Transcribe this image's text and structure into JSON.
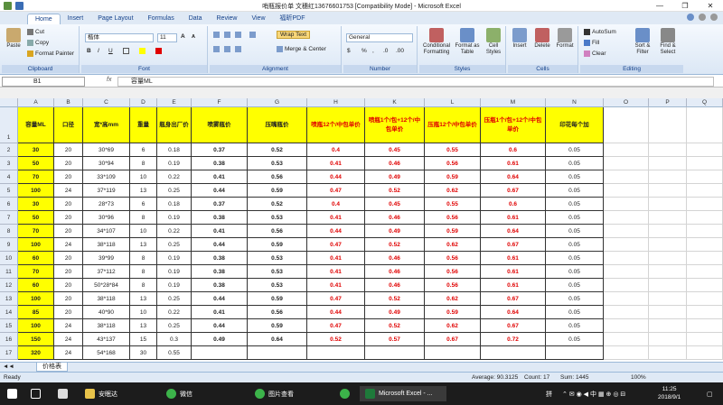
{
  "window": {
    "title": "哨瓶报价单 文穗红13676601753 [Compatibility Mode] - Microsoft Excel",
    "minimize": "—",
    "restore": "❐",
    "close": "✕"
  },
  "tabs": [
    "Home",
    "Insert",
    "Page Layout",
    "Formulas",
    "Data",
    "Review",
    "View",
    "福昕PDF"
  ],
  "ribbon": {
    "clipboard": {
      "label": "Clipboard",
      "paste": "Paste",
      "cut": "Cut",
      "copy": "Copy",
      "format_painter": "Format Painter"
    },
    "font": {
      "label": "Font",
      "font_name": "楷体",
      "font_size": "11",
      "bold": "B",
      "italic": "I",
      "underline": "U",
      "grow": "A",
      "shrink": "A"
    },
    "alignment": {
      "label": "Alignment",
      "wrap_text": "Wrap Text",
      "merge_center": "Merge & Center"
    },
    "number": {
      "label": "Number",
      "format": "General",
      "currency": "$",
      "percent": "%",
      "comma": ",",
      "inc_dec": ".0",
      "dec_dec": ".00"
    },
    "styles": {
      "label": "Styles",
      "conditional": "Conditional Formatting",
      "format_table": "Format as Table",
      "cell_styles": "Cell Styles"
    },
    "cells": {
      "label": "Cells",
      "insert": "Insert",
      "delete": "Delete",
      "format": "Format"
    },
    "editing": {
      "label": "Editing",
      "autosum": "AutoSum",
      "fill": "Fill",
      "clear": "Clear",
      "sort_filter": "Sort & Filter",
      "find_select": "Find & Select"
    }
  },
  "formula_bar": {
    "name_box": "B1",
    "fx": "fx",
    "content": "容量ML"
  },
  "columns": [
    "A",
    "B",
    "C",
    "D",
    "E",
    "F",
    "G",
    "H",
    "K",
    "L",
    "M",
    "N",
    "O",
    "P",
    "Q",
    "R"
  ],
  "headers": [
    "容量ML",
    "口径",
    "宽*高mm",
    "重量",
    "瓶身出厂价",
    "喷雾瓶价",
    "压嘴瓶价",
    "喷瓶12个/中包单价",
    "喷瓶1个/包+12个/中包单价",
    "压瓶12个/中包单价",
    "压瓶1个/包+12个/中包单价",
    "印花每个加"
  ],
  "rows": [
    [
      "30",
      "20",
      "30*69",
      "6",
      "0.18",
      "0.37",
      "0.52",
      "0.4",
      "0.45",
      "0.55",
      "0.6",
      "0.05"
    ],
    [
      "50",
      "20",
      "30*94",
      "8",
      "0.19",
      "0.38",
      "0.53",
      "0.41",
      "0.46",
      "0.56",
      "0.61",
      "0.05"
    ],
    [
      "70",
      "20",
      "33*109",
      "10",
      "0.22",
      "0.41",
      "0.56",
      "0.44",
      "0.49",
      "0.59",
      "0.64",
      "0.05"
    ],
    [
      "100",
      "24",
      "37*119",
      "13",
      "0.25",
      "0.44",
      "0.59",
      "0.47",
      "0.52",
      "0.62",
      "0.67",
      "0.05"
    ],
    [
      "30",
      "20",
      "28*73",
      "6",
      "0.18",
      "0.37",
      "0.52",
      "0.4",
      "0.45",
      "0.55",
      "0.6",
      "0.05"
    ],
    [
      "50",
      "20",
      "30*96",
      "8",
      "0.19",
      "0.38",
      "0.53",
      "0.41",
      "0.46",
      "0.56",
      "0.61",
      "0.05"
    ],
    [
      "70",
      "20",
      "34*107",
      "10",
      "0.22",
      "0.41",
      "0.56",
      "0.44",
      "0.49",
      "0.59",
      "0.64",
      "0.05"
    ],
    [
      "100",
      "24",
      "38*118",
      "13",
      "0.25",
      "0.44",
      "0.59",
      "0.47",
      "0.52",
      "0.62",
      "0.67",
      "0.05"
    ],
    [
      "60",
      "20",
      "39*99",
      "8",
      "0.19",
      "0.38",
      "0.53",
      "0.41",
      "0.46",
      "0.56",
      "0.61",
      "0.05"
    ],
    [
      "70",
      "20",
      "37*112",
      "8",
      "0.19",
      "0.38",
      "0.53",
      "0.41",
      "0.46",
      "0.56",
      "0.61",
      "0.05"
    ],
    [
      "60",
      "20",
      "50*28*84",
      "8",
      "0.19",
      "0.38",
      "0.53",
      "0.41",
      "0.46",
      "0.56",
      "0.61",
      "0.05"
    ],
    [
      "100",
      "20",
      "38*118",
      "13",
      "0.25",
      "0.44",
      "0.59",
      "0.47",
      "0.52",
      "0.62",
      "0.67",
      "0.05"
    ],
    [
      "85",
      "20",
      "40*90",
      "10",
      "0.22",
      "0.41",
      "0.56",
      "0.44",
      "0.49",
      "0.59",
      "0.64",
      "0.05"
    ],
    [
      "100",
      "24",
      "38*118",
      "13",
      "0.25",
      "0.44",
      "0.59",
      "0.47",
      "0.52",
      "0.62",
      "0.67",
      "0.05"
    ],
    [
      "150",
      "24",
      "43*137",
      "15",
      "0.3",
      "0.49",
      "0.64",
      "0.52",
      "0.57",
      "0.67",
      "0.72",
      "0.05"
    ],
    [
      "320",
      "24",
      "54*168",
      "30",
      "0.55",
      "",
      "",
      "",
      "",
      "",
      "",
      ""
    ]
  ],
  "sheet_tab": "价格表",
  "status": {
    "ready": "Ready",
    "average": "Average: 90.3125",
    "count": "Count: 17",
    "sum": "Sum: 1445",
    "zoom": "100%"
  },
  "taskbar": {
    "items": [
      "安眠达",
      "微信",
      "图片查看",
      "Microsoft Excel - ..."
    ],
    "ime": "拼",
    "time": "11:25",
    "date": "2018/9/1"
  },
  "colors": {
    "header_fill": "#ffff00",
    "red_text": "#e00000",
    "ribbon_blue": "#dfe9f5"
  }
}
